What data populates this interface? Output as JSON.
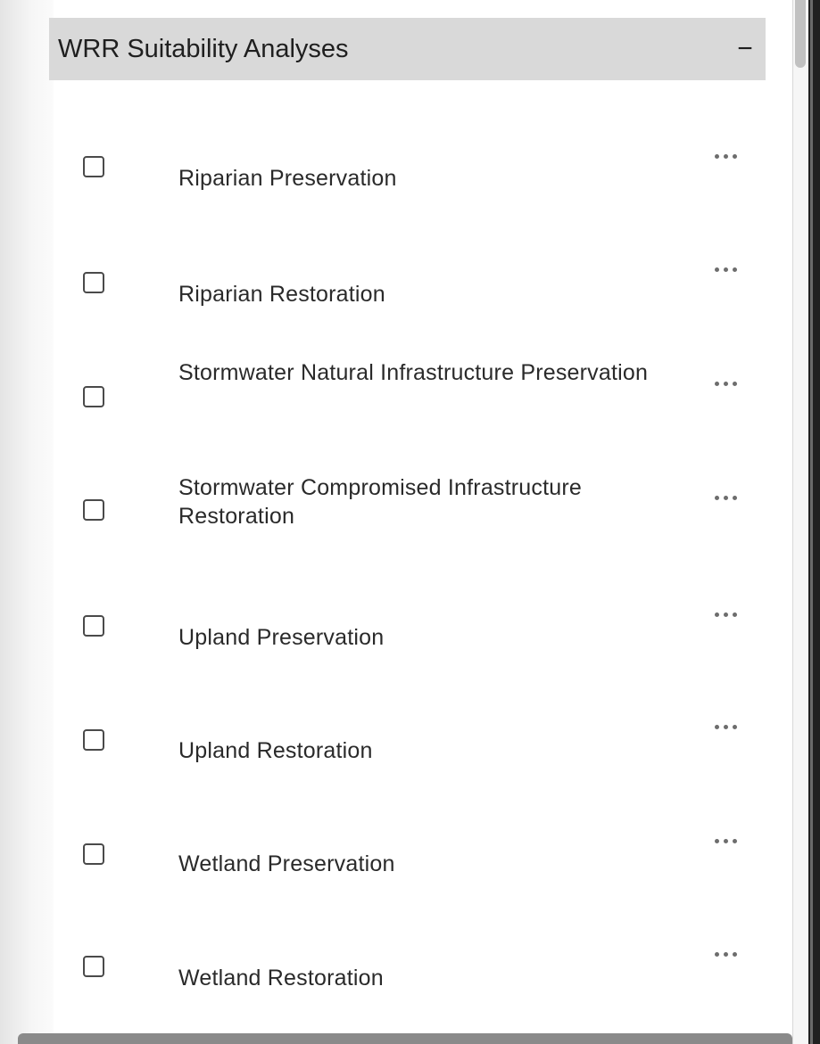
{
  "group": {
    "title": "WRR Suitability Analyses",
    "collapse_symbol": "−",
    "collapse_icon": "minus-icon"
  },
  "layers": [
    {
      "label": "Riparian Preservation",
      "checked": false
    },
    {
      "label": "Riparian Restoration",
      "checked": false
    },
    {
      "label": "Stormwater Natural Infrastructure Preservation",
      "checked": false
    },
    {
      "label": "Stormwater Compromised Infrastructure Restoration",
      "checked": false
    },
    {
      "label": "Upland Preservation",
      "checked": false
    },
    {
      "label": "Upland Restoration",
      "checked": false
    },
    {
      "label": "Wetland Preservation",
      "checked": false
    },
    {
      "label": "Wetland Restoration",
      "checked": false
    }
  ],
  "icons": {
    "more": "more-options-icon",
    "checkbox": "checkbox-unchecked"
  },
  "colors": {
    "header_background": "#d9d9d9",
    "panel_background": "#ffffff",
    "text": "#2a2a2a",
    "icon": "#6d6d6d"
  }
}
